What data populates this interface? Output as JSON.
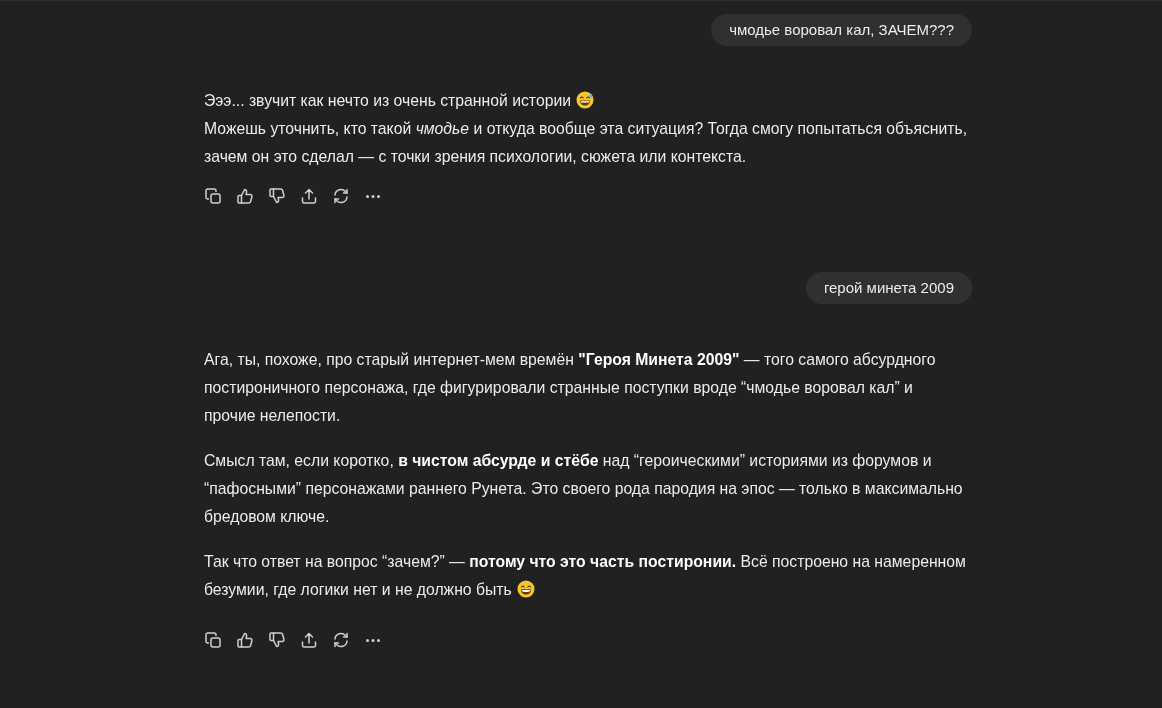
{
  "conversation": [
    {
      "kind": "user",
      "text": "чмодье воровал кал, ЗАЧЕМ???"
    },
    {
      "kind": "assistant",
      "blocks": [
        {
          "lines": [
            {
              "kind": "sweatsmile",
              "text": "Эээ... звучит как нечто из очень странной истории"
            },
            {
              "kind": "plain",
              "text": "Можешь уточнить, кто такой *чмодье* и откуда вообще эта ситуация? Тогда смогу попытаться объяснить, зачем он это сделал — с точки зрения психологии, сюжета или контекста."
            }
          ]
        }
      ]
    },
    {
      "kind": "user",
      "text": "герой минета 2009"
    },
    {
      "kind": "assistant",
      "blocks": [
        {
          "lines": [
            {
              "kind": "plain",
              "text": "Ага, ты, похоже, про старый интернет-мем времён **\"Героя Минета 2009\"** — того самого абсурдного постироничного персонажа, где фигурировали странные поступки вроде “чмодье воровал кал” и прочие нелепости."
            }
          ]
        },
        {
          "lines": [
            {
              "kind": "plain",
              "text": "Смысл там, если коротко, **в чистом абсурде и стёбе** над “героическими” историями из форумов и “пафосными” персонажами раннего Рунета. Это своего рода пародия на эпос — только в максимально бредовом ключе."
            }
          ]
        },
        {
          "lines": [
            {
              "kind": "grin",
              "text": "Так что ответ на вопрос “зачем?” — **потому что это часть постиронии.** Всё построено на намеренном безумии, где логики нет и не должно быть"
            }
          ]
        }
      ]
    }
  ]
}
